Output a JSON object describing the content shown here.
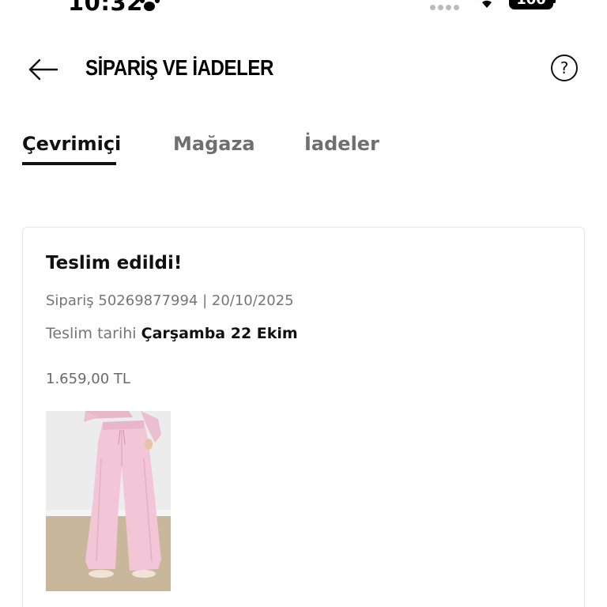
{
  "status_bar": {
    "time": "10:32",
    "battery": "100"
  },
  "header": {
    "title": "SİPARİŞ VE İADELER",
    "help_label": "?"
  },
  "tabs": [
    {
      "label": "Çevrimiçi",
      "active": true
    },
    {
      "label": "Mağaza",
      "active": false
    },
    {
      "label": "İadeler",
      "active": false
    }
  ],
  "order": {
    "status": "Teslim edildi!",
    "meta": "Sipariş 50269877994 | 20/10/2025",
    "delivery_label": "Teslim tarihi",
    "delivery_date": "Çarşamba 22 Ekim",
    "price": "1.659,00 TL",
    "product_image_icon": "pink-wide-leg-pants-photo"
  },
  "colors": {
    "text_primary": "#111111",
    "text_secondary": "#767676",
    "border": "#e6e6e6",
    "product_pink": "#f2c6d6"
  }
}
